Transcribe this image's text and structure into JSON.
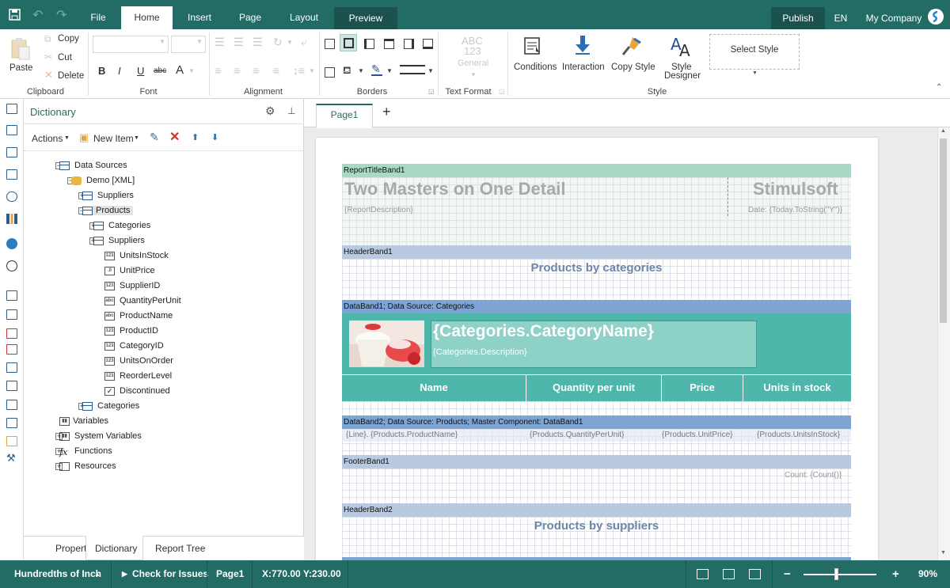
{
  "topbar": {
    "menus": [
      "File",
      "Home",
      "Insert",
      "Page",
      "Layout",
      "Preview"
    ],
    "publish": "Publish",
    "lang": "EN",
    "company": "My Company"
  },
  "ribbon": {
    "clipboard": {
      "paste": "Paste",
      "copy": "Copy",
      "cut": "Cut",
      "delete": "Delete",
      "label": "Clipboard"
    },
    "font": {
      "bold": "B",
      "italic": "I",
      "underline": "U",
      "strike": "abc",
      "color": "A",
      "label": "Font"
    },
    "alignment": {
      "label": "Alignment"
    },
    "borders": {
      "label": "Borders"
    },
    "text_format": {
      "abc": "ABC",
      "num": "123",
      "general": "General",
      "label": "Text Format"
    },
    "style": {
      "conditions": "Conditions",
      "interaction": "Interaction",
      "copy_style": "Copy Style",
      "style_designer_1": "Style",
      "style_designer_2": "Designer",
      "select_style": "Select Style",
      "label": "Style"
    }
  },
  "dictionary": {
    "title": "Dictionary",
    "actions": "Actions",
    "new_item": "New Item",
    "tree": [
      {
        "label": "Data Sources",
        "level": 0,
        "toggle": "−",
        "icon": "table"
      },
      {
        "label": "Demo [XML]",
        "level": 1,
        "toggle": "−",
        "icon": "db"
      },
      {
        "label": "Suppliers",
        "level": 2,
        "toggle": "+",
        "icon": "table"
      },
      {
        "label": "Products",
        "level": 2,
        "toggle": "−",
        "icon": "table",
        "selected": true
      },
      {
        "label": "Categories",
        "level": 3,
        "toggle": "+",
        "icon": "relation"
      },
      {
        "label": "Suppliers",
        "level": 3,
        "toggle": "+",
        "icon": "relation"
      },
      {
        "label": "UnitsInStock",
        "level": 4,
        "toggle": "",
        "icon": "123"
      },
      {
        "label": "UnitPrice",
        "level": 4,
        "toggle": "",
        "icon": ".0"
      },
      {
        "label": "SupplierID",
        "level": 4,
        "toggle": "",
        "icon": "123"
      },
      {
        "label": "QuantityPerUnit",
        "level": 4,
        "toggle": "",
        "icon": "abc"
      },
      {
        "label": "ProductName",
        "level": 4,
        "toggle": "",
        "icon": "abc"
      },
      {
        "label": "ProductID",
        "level": 4,
        "toggle": "",
        "icon": "123"
      },
      {
        "label": "CategoryID",
        "level": 4,
        "toggle": "",
        "icon": "123"
      },
      {
        "label": "UnitsOnOrder",
        "level": 4,
        "toggle": "",
        "icon": "123"
      },
      {
        "label": "ReorderLevel",
        "level": 4,
        "toggle": "",
        "icon": "123"
      },
      {
        "label": "Discontinued",
        "level": 4,
        "toggle": "",
        "icon": "check"
      },
      {
        "label": "Categories",
        "level": 2,
        "toggle": "+",
        "icon": "table"
      },
      {
        "label": "Variables",
        "level": -1,
        "toggle": "",
        "icon": "var"
      },
      {
        "label": "System Variables",
        "level": 0,
        "toggle": "+",
        "icon": "sysvar"
      },
      {
        "label": "Functions",
        "level": 0,
        "toggle": "+",
        "icon": "fx"
      },
      {
        "label": "Resources",
        "level": 0,
        "toggle": "+",
        "icon": "res"
      }
    ],
    "tabs": [
      "Properties",
      "Dictionary",
      "Report Tree"
    ]
  },
  "canvas": {
    "page_tab": "Page1",
    "add": "+",
    "report": {
      "title_band": "ReportTitleBand1",
      "title": "Two Masters on One Detail",
      "brand": "Stimulsoft",
      "description": "{ReportDescription}",
      "date": "Date: {Today.ToString(\"Y\")}",
      "header_band1": "HeaderBand1",
      "header1_text": "Products by categories",
      "data_band1": "DataBand1; Data Source: Categories",
      "category_name": "{Categories.CategoryName}",
      "category_desc": "{Categories.Description}",
      "columns": [
        "Name",
        "Quantity per unit",
        "Price",
        "Units in stock"
      ],
      "data_band2": "DataBand2; Data Source: Products; Master Component: DataBand1",
      "row": [
        "{Line}. {Products.ProductName}",
        "{Products.QuantityPerUnit}",
        "{Products.UnitPrice}",
        "{Products.UnitsInStock}"
      ],
      "footer_band1": "FooterBand1",
      "count": "Count: {Count()}",
      "header_band2": "HeaderBand2",
      "header2_text": "Products by suppliers"
    }
  },
  "status": {
    "units": "Hundredths of Inch",
    "check": "Check for Issues",
    "page": "Page1",
    "coords": "X:770.00 Y:230.00",
    "zoom": "90%",
    "minus": "−",
    "plus": "+"
  },
  "colors": {
    "teal": "#236c66",
    "band_title": "#a9d9c4",
    "band_header": "#b8c9e0",
    "band_data": "#7ea4d3",
    "category_bg": "#4fb6ab"
  }
}
